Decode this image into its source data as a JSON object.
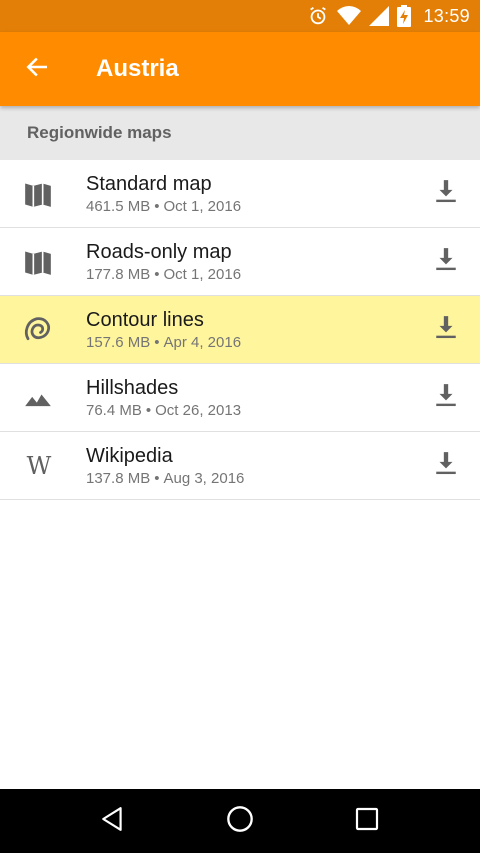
{
  "status_bar": {
    "time": "13:59",
    "icons": [
      "alarm-icon",
      "wifi-icon",
      "signal-icon",
      "battery-charging-icon"
    ]
  },
  "app_bar": {
    "title": "Austria",
    "back_icon": "arrow-back-icon",
    "background": "#ff8c00",
    "status_background": "#e37f07"
  },
  "section": {
    "header": "Regionwide maps"
  },
  "items": [
    {
      "name": "Standard map",
      "size": "461.5 MB",
      "date": "Oct 1, 2016",
      "icon": "map-icon",
      "highlighted": false
    },
    {
      "name": "Roads-only map",
      "size": "177.8 MB",
      "date": "Oct 1, 2016",
      "icon": "map-icon",
      "highlighted": false
    },
    {
      "name": "Contour lines",
      "size": "157.6 MB",
      "date": "Apr 4, 2016",
      "icon": "contour-icon",
      "highlighted": true
    },
    {
      "name": "Hillshades",
      "size": "76.4 MB",
      "date": "Oct 26, 2013",
      "icon": "mountain-icon",
      "highlighted": false
    },
    {
      "name": "Wikipedia",
      "size": "137.8 MB",
      "date": "Aug 3, 2016",
      "icon": "wikipedia-icon",
      "highlighted": false
    }
  ],
  "separator": "•",
  "wikipedia_glyph": "W",
  "highlight_color": "#fff59d",
  "nav_bar": {
    "buttons": [
      "back-triangle-icon",
      "home-circle-icon",
      "recents-square-icon"
    ]
  }
}
